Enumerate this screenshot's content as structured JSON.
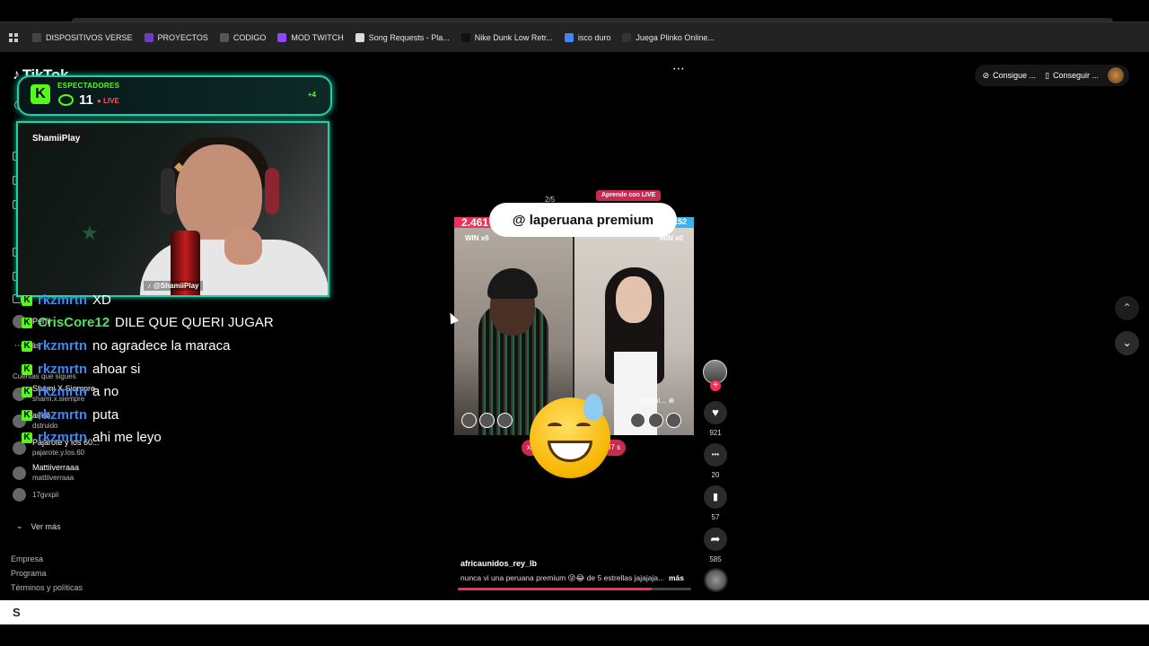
{
  "bookmarks": [
    {
      "label": "DISPOSITIVOS VERSE",
      "color": "#444444"
    },
    {
      "label": "PROYECTOS",
      "color": "#6b3fc4"
    },
    {
      "label": "CODIGO",
      "color": "#555555"
    },
    {
      "label": "MOD TWITCH",
      "color": "#9146ff"
    },
    {
      "label": "Song Requests - Pla...",
      "color": "#dddddd"
    },
    {
      "label": "Nike Dunk Low Retr...",
      "color": "#111111"
    },
    {
      "label": "isco duro",
      "color": "#4285f4"
    },
    {
      "label": "Juega Plinko Online...",
      "color": "#333333"
    }
  ],
  "tiktok": {
    "logo": "TikTok"
  },
  "sidebar": {
    "perfil": "Perfil",
    "mas": "Más",
    "following_title": "Cuentas que sigues",
    "accounts": [
      {
        "name": "Shami X Siempre",
        "user": "shami.x.siempre"
      },
      {
        "name": "aireb",
        "user": "dstruido"
      },
      {
        "name": "Pajarote y los 60...",
        "user": "pajarote.y.los.60"
      },
      {
        "name": "Mattiiverraaa",
        "user": "mattiiverraaa"
      },
      {
        "name": "",
        "user": "17gvxpii"
      }
    ],
    "ver_mas": "Ver más",
    "footer": [
      "Empresa",
      "Programa",
      "Términos y políticas"
    ]
  },
  "stream": {
    "viewers_label": "ESPECTADORES",
    "viewers_count": "11",
    "live": "LIVE",
    "plus": "+4",
    "streamer": "ShamiiPlay",
    "handle": "@ShamiiPlay"
  },
  "chat": [
    {
      "user": "rkzmrtn",
      "msg": "XD",
      "green": false
    },
    {
      "user": "CrisCore12",
      "msg": "DILE QUE QUERI JUGAR",
      "green": true
    },
    {
      "user": "rkzmrtn",
      "msg": "no agradece la maraca",
      "green": false
    },
    {
      "user": "rkzmrtn",
      "msg": "ahoar si",
      "green": false
    },
    {
      "user": "rkzmrtn",
      "msg": "a no",
      "green": false
    },
    {
      "user": "rkzmrtn",
      "msg": "puta",
      "green": false
    },
    {
      "user": "rkzmrtn",
      "msg": "ahi me leyo",
      "green": false
    }
  ],
  "video": {
    "banner": "@ laperuana premium",
    "aprende": "Aprende con LIVE",
    "page_indicator": "2/5",
    "score_left": "2.461",
    "score_right": "152",
    "win_left": "WIN x6",
    "win_right": "WIN x0",
    "right_name": "Sarahí...",
    "pill_left": "x2",
    "pill_right": "37 s",
    "caption_user": "africaunidos_rey_lb",
    "caption_text": "nunca vi una peruana premium 😜😂 de 5 estrellas jajajaja...",
    "caption_more": "más",
    "progress": 0.83
  },
  "actions": {
    "likes": "921",
    "comments": "20",
    "saves": "57",
    "shares": "585"
  },
  "top_right": {
    "btn1": "Consigue ...",
    "btn2": "Conseguir ..."
  },
  "icons": {
    "more": "⋯",
    "heart": "♥",
    "comment": "•••",
    "bookmark": "▮",
    "share": "➦",
    "up": "⌃",
    "down": "⌄"
  }
}
